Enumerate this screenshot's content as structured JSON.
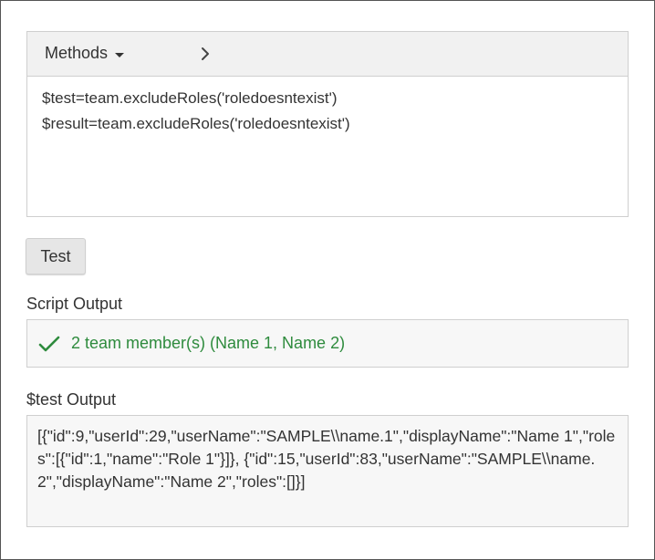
{
  "editor": {
    "methods_label": "Methods",
    "code_lines": [
      "$test=team.excludeRoles('roledoesntexist')",
      "$result=team.excludeRoles('roledoesntexist')"
    ]
  },
  "actions": {
    "test_label": "Test"
  },
  "script_output": {
    "label": "Script Output",
    "status": "success",
    "message": "2 team member(s) (Name 1, Name 2)",
    "colors": {
      "success": "#2e8b3d"
    }
  },
  "test_output": {
    "label": "$test Output",
    "content": "[{\"id\":9,\"userId\":29,\"userName\":\"SAMPLE\\\\name.1\",\"displayName\":\"Name 1\",\"roles\":[{\"id\":1,\"name\":\"Role 1\"}]}, {\"id\":15,\"userId\":83,\"userName\":\"SAMPLE\\\\name.2\",\"displayName\":\"Name 2\",\"roles\":[]}]"
  },
  "icons": {
    "methods_dropdown": "caret-down-icon",
    "next": "chevron-right-icon",
    "success": "checkmark-icon"
  }
}
